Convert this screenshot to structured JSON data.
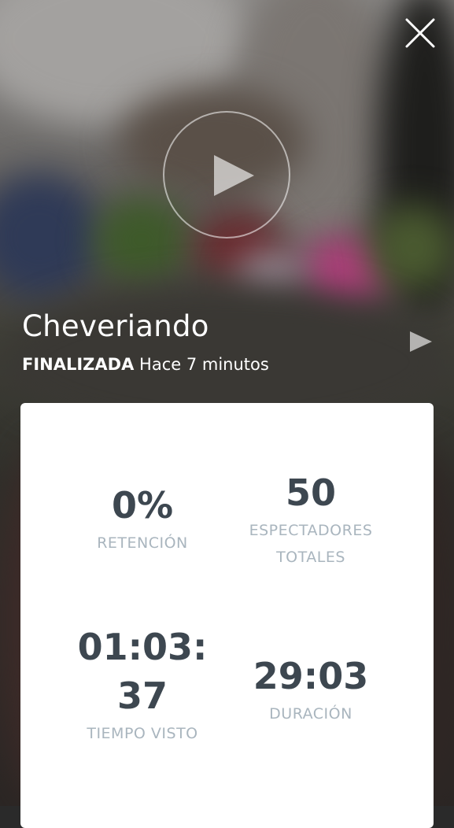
{
  "broadcast": {
    "title": "Cheveriando",
    "status": "FINALIZADA",
    "time_ago": "Hace 7 minutos"
  },
  "icons": {
    "close": "close-icon",
    "play": "play-icon",
    "side_play": "play-small-icon"
  },
  "stats": {
    "retention": {
      "value": "0%",
      "label": "RETENCIÓN"
    },
    "viewers": {
      "value": "50",
      "label_line1": "ESPECTADORES",
      "label_line2": "TOTALES"
    },
    "time_watched": {
      "value_line1": "01:03:",
      "value_line2": "37",
      "label": "TIEMPO VISTO"
    },
    "duration": {
      "value": "29:03",
      "label": "DURACIÓN"
    }
  },
  "colors": {
    "stat_value": "#3d4750",
    "stat_label": "#a9b5be",
    "card_background": "#ffffff",
    "overlay_text": "#ffffff"
  }
}
